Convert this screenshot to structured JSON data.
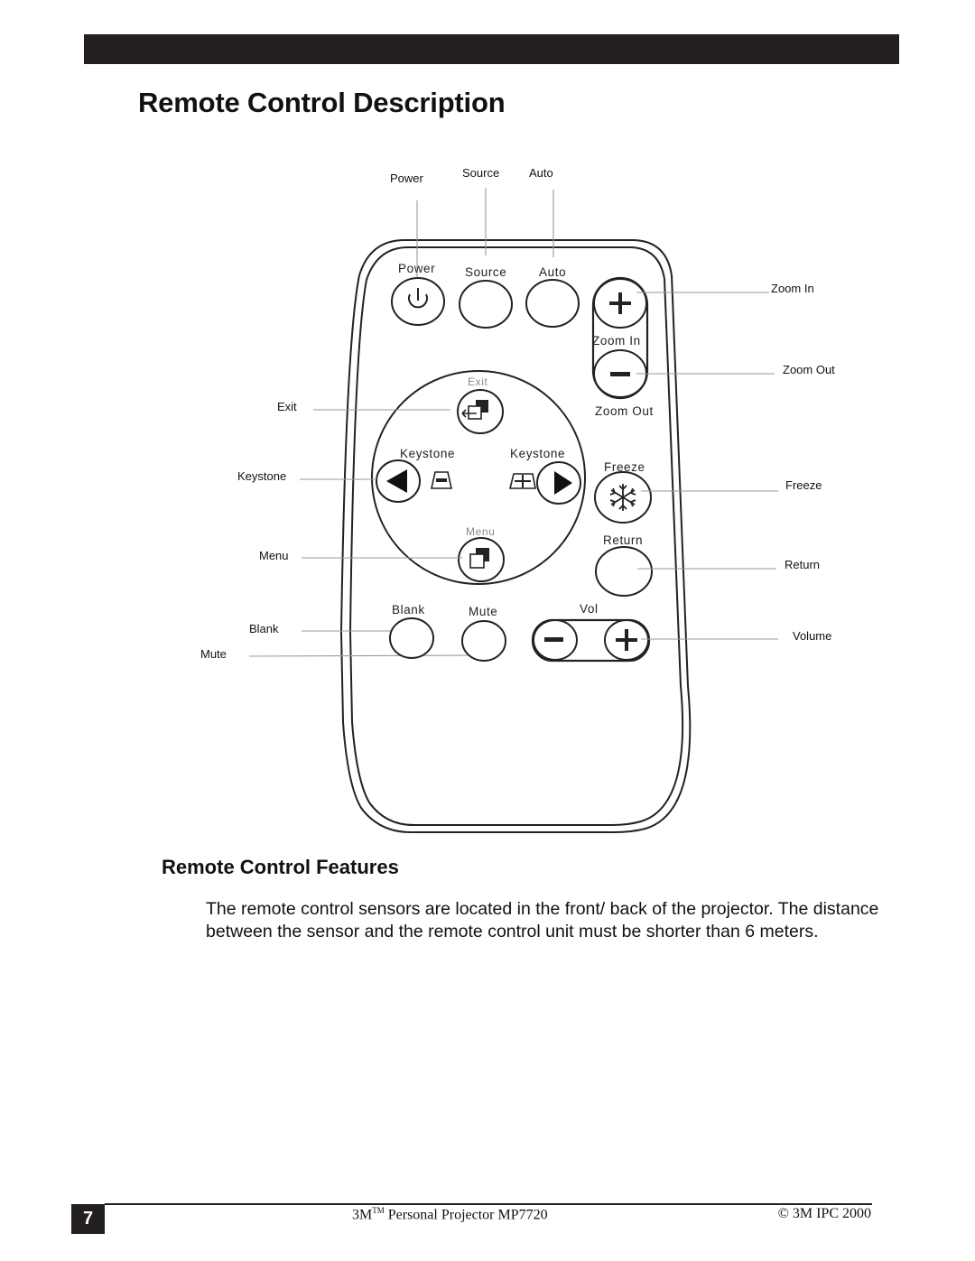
{
  "header": {
    "title": "Remote Control Description"
  },
  "diagram": {
    "callouts": {
      "power": "Power",
      "source": "Source",
      "auto": "Auto",
      "zoom_in": "Zoom In",
      "zoom_out": "Zoom Out",
      "exit": "Exit",
      "keystone": "Keystone",
      "freeze": "Freeze",
      "menu": "Menu",
      "return": "Return",
      "blank": "Blank",
      "volume": "Volume",
      "mute": "Mute"
    },
    "remote_labels": {
      "power": "Power",
      "source": "Source",
      "auto": "Auto",
      "zoom_in": "Zoom In",
      "zoom_out": "Zoom Out",
      "exit": "Exit",
      "keystone_left": "Keystone",
      "keystone_right": "Keystone",
      "freeze": "Freeze",
      "menu": "Menu",
      "return": "Return",
      "blank": "Blank",
      "mute": "Mute",
      "vol": "Vol"
    }
  },
  "features": {
    "heading": "Remote Control Features",
    "paragraph": "The remote control sensors are located in the front/ back of the projector. The distance between the sensor and the remote control unit must be shorter than 6 meters."
  },
  "footer": {
    "page_number": "7",
    "product_prefix": "3M",
    "trademark": "TM",
    "product_name": " Personal Projector MP7720",
    "copyright": "© 3M IPC 2000"
  }
}
